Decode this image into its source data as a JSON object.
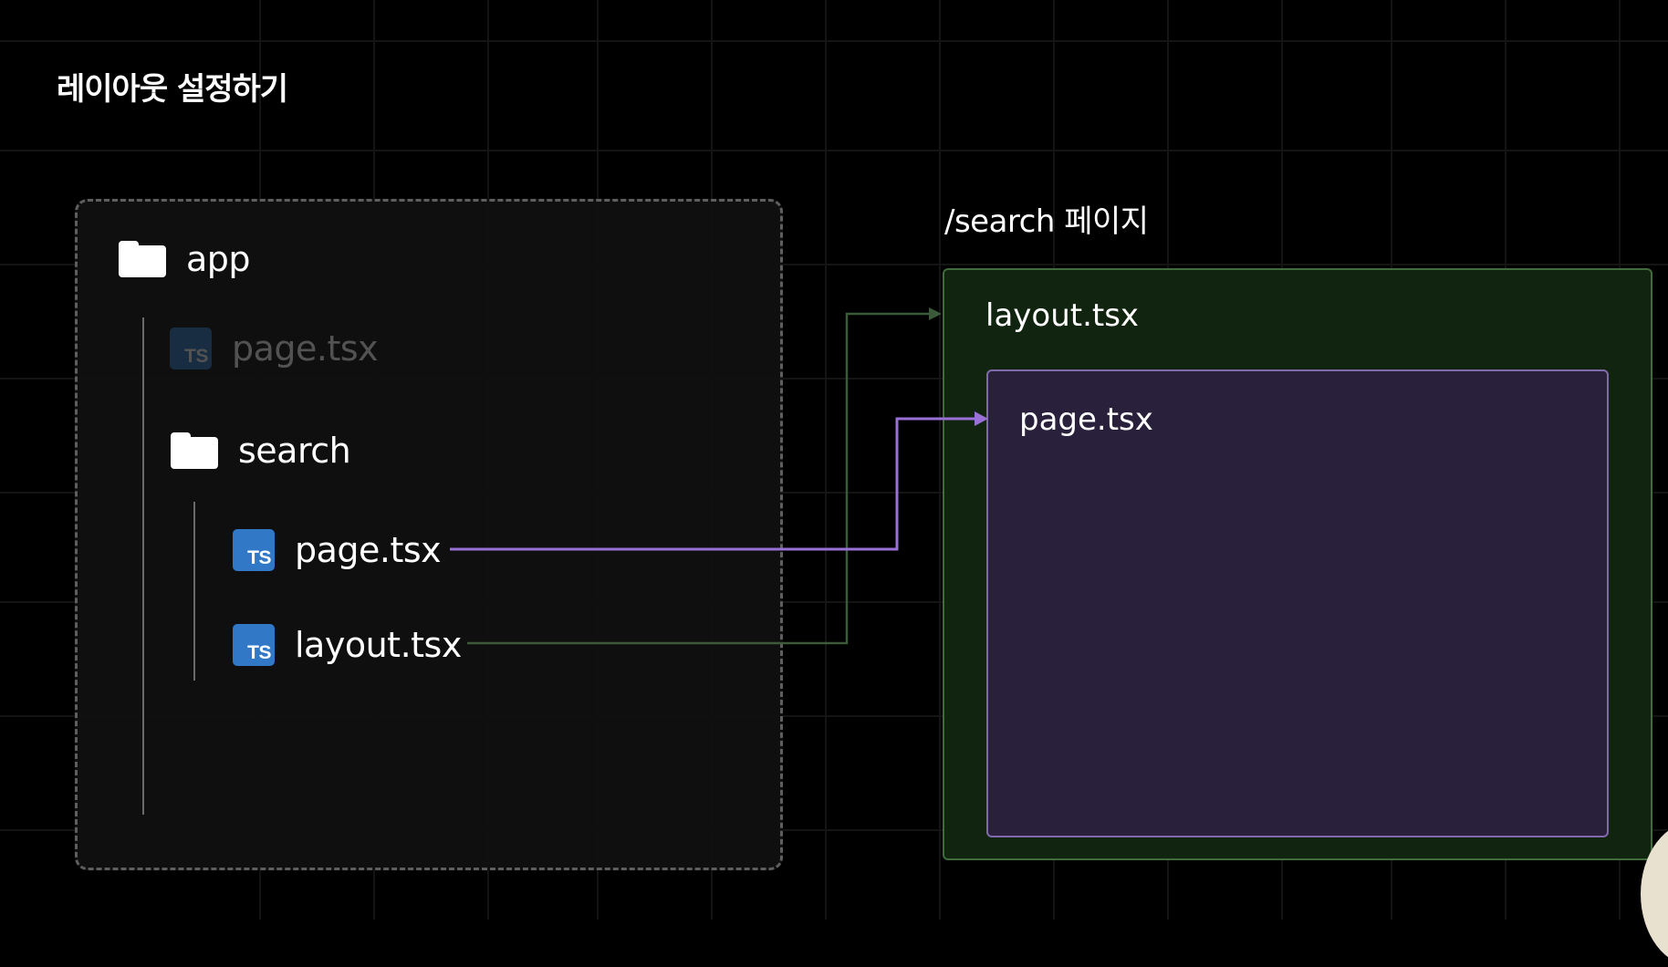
{
  "title": "레이아웃 설정하기",
  "tree": {
    "root": "app",
    "root_page": "page.tsx",
    "folder": "search",
    "search_page": "page.tsx",
    "search_layout": "layout.tsx",
    "ts_badge": "TS",
    "icons": {
      "folder": "folder-icon",
      "file": "typescript-file-icon"
    }
  },
  "route": {
    "title": "/search 페이지",
    "layout_label": "layout.tsx",
    "page_label": "page.tsx"
  },
  "colors": {
    "background": "#000000",
    "tree_border": "#5e5e5e",
    "layout_fill": "#11240f",
    "layout_border": "#3f6c3a",
    "page_fill": "#29203c",
    "page_border": "#8169ad",
    "page_arrow": "#9a6fd6",
    "layout_arrow": "#3a5a3a",
    "ts_icon": "#3178c6"
  }
}
